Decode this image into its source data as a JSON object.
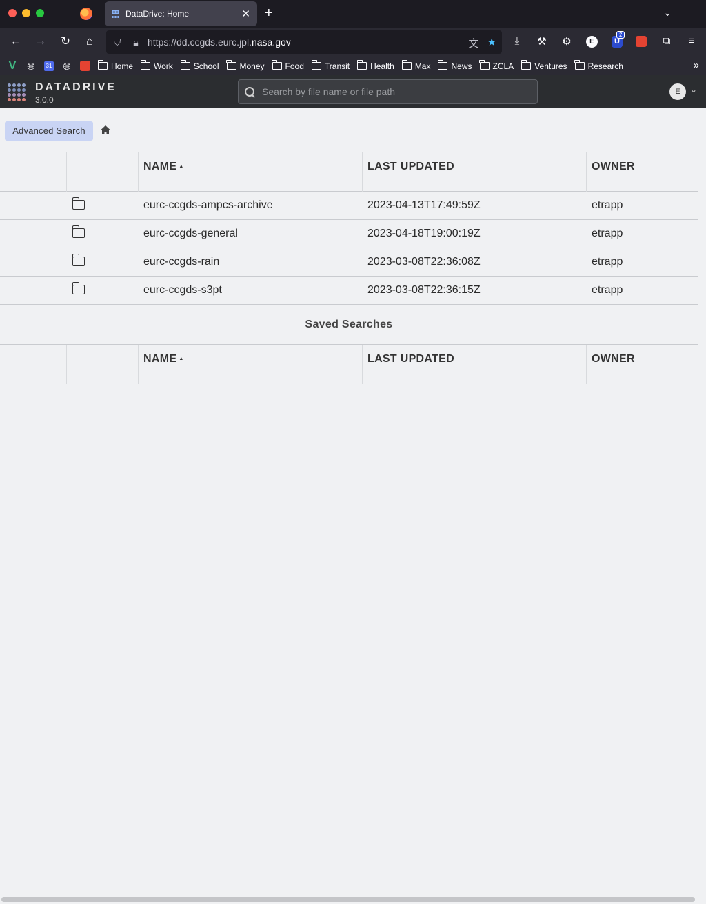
{
  "browser": {
    "tab_title": "DataDrive: Home",
    "url_prefix": "https://dd.ccgds.eurc.jpl.",
    "url_host": "nasa.gov",
    "profile_initial": "E",
    "extension_badge": "2",
    "bookmarks": [
      "Home",
      "Work",
      "School",
      "Money",
      "Food",
      "Transit",
      "Health",
      "Max",
      "News",
      "ZCLA",
      "Ventures",
      "Research"
    ]
  },
  "app": {
    "brand": "DATADRIVE",
    "version": "3.0.0",
    "search_placeholder": "Search by file name or file path",
    "user_initial": "E"
  },
  "toolbar": {
    "advanced_search_label": "Advanced Search"
  },
  "files_table": {
    "columns": [
      "NAME",
      "LAST UPDATED",
      "OWNER"
    ],
    "sort_indicator": "▲",
    "rows": [
      {
        "name": "eurc-ccgds-ampcs-archive",
        "updated": "2023-04-13T17:49:59Z",
        "owner": "etrapp"
      },
      {
        "name": "eurc-ccgds-general",
        "updated": "2023-04-18T19:00:19Z",
        "owner": "etrapp"
      },
      {
        "name": "eurc-ccgds-rain",
        "updated": "2023-03-08T22:36:08Z",
        "owner": "etrapp"
      },
      {
        "name": "eurc-ccgds-s3pt",
        "updated": "2023-03-08T22:36:15Z",
        "owner": "etrapp"
      }
    ]
  },
  "saved_searches": {
    "title": "Saved Searches",
    "columns": [
      "NAME",
      "LAST UPDATED",
      "OWNER"
    ]
  },
  "colors": {
    "accent_button": "#c9d4f4",
    "app_header": "#2b2d30",
    "page_background": "#f0f1f3"
  }
}
